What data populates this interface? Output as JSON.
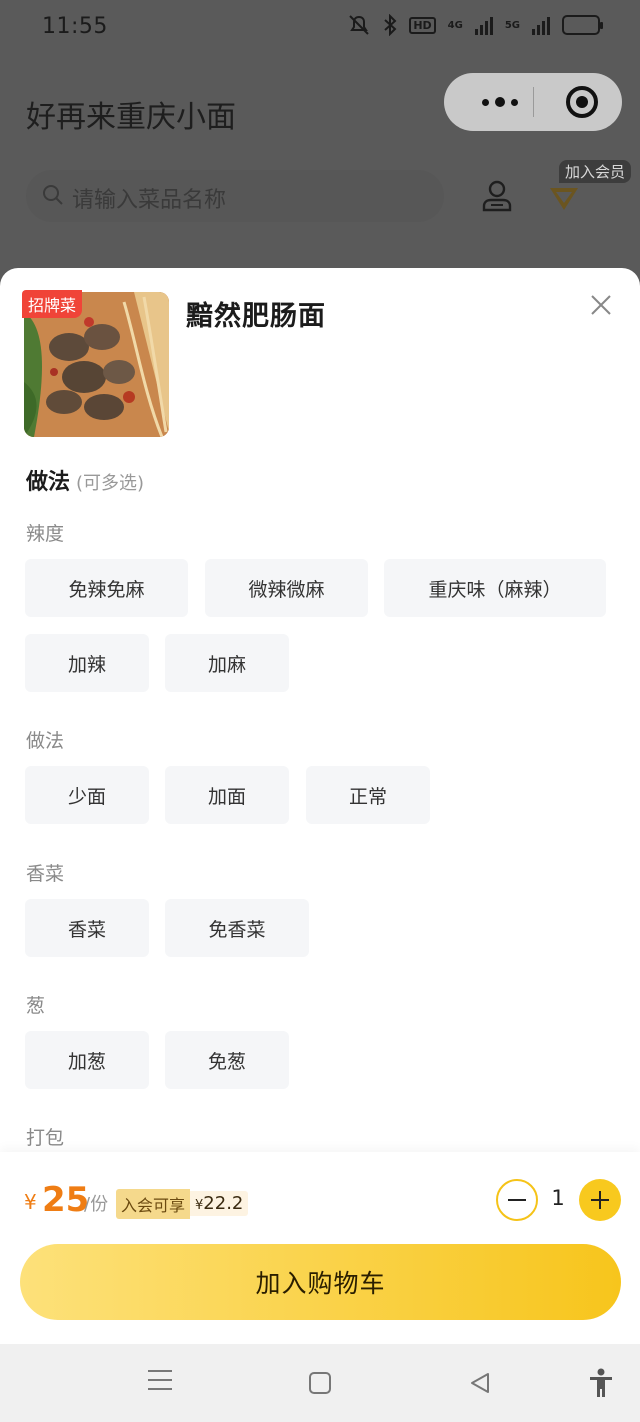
{
  "status_bar": {
    "time": "11:55",
    "net1": "4G",
    "net2": "5G",
    "hd": "HD"
  },
  "header": {
    "title": "好再来重庆小面",
    "search_placeholder": "请输入菜品名称",
    "member_badge": "加入会员"
  },
  "dish": {
    "badge": "招牌菜",
    "name": "黯然肥肠面"
  },
  "options": {
    "title": "做法",
    "hint": "(可多选)",
    "groups": [
      {
        "label": "辣度",
        "items": [
          "免辣免麻",
          "微辣微麻",
          "重庆味（麻辣）",
          "加辣",
          "加麻"
        ]
      },
      {
        "label": "做法",
        "items": [
          "少面",
          "加面",
          "正常"
        ]
      },
      {
        "label": "香菜",
        "items": [
          "香菜",
          "免香菜"
        ]
      },
      {
        "label": "葱",
        "items": [
          "加葱",
          "免葱"
        ]
      },
      {
        "label": "打包",
        "items": []
      }
    ]
  },
  "bottom": {
    "currency": "¥",
    "price": "25",
    "unit": "/份",
    "member_label": "入会可享",
    "member_currency": "¥",
    "member_price": "22.2",
    "quantity": "1",
    "cart_button": "加入购物车"
  },
  "colors": {
    "accent": "#F8C91E",
    "price": "#EF7D14",
    "badge": "#F04438"
  }
}
